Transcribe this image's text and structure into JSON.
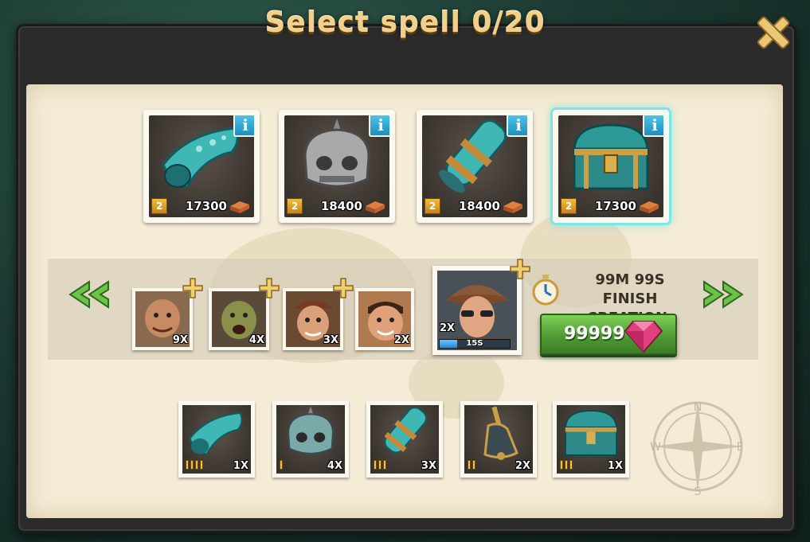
{
  "header": {
    "title": "Select spell 0/20"
  },
  "spells": [
    {
      "name": "horn",
      "level": "2",
      "cost": "17300",
      "selected": false
    },
    {
      "name": "skull-helmet",
      "level": "2",
      "cost": "18400",
      "selected": false
    },
    {
      "name": "cannon",
      "level": "2",
      "cost": "18400",
      "selected": false
    },
    {
      "name": "treasure-chest",
      "level": "2",
      "cost": "17300",
      "selected": true
    }
  ],
  "queue": {
    "units": [
      {
        "name": "ogre",
        "count": "9X"
      },
      {
        "name": "goblin",
        "count": "4X"
      },
      {
        "name": "pirate",
        "count": "3X"
      },
      {
        "name": "brawler",
        "count": "2X"
      }
    ],
    "active": {
      "name": "detective",
      "count": "2X",
      "timer": "15S",
      "progress": 0.25
    },
    "time_remaining": "99M  99S",
    "finish_label": "FINISH CREATION:",
    "finish_cost": "99999"
  },
  "inventory": [
    {
      "name": "horn",
      "count": "1X",
      "tally": 4
    },
    {
      "name": "skull-helmet",
      "count": "4X",
      "tally": 1
    },
    {
      "name": "cannon",
      "count": "3X",
      "tally": 3
    },
    {
      "name": "bell",
      "count": "2X",
      "tally": 2
    },
    {
      "name": "treasure-chest",
      "count": "1X",
      "tally": 3
    }
  ],
  "colors": {
    "title": "#f0d08a",
    "parchment": "#f4ecd6",
    "selected_glow": "#7fe5e2",
    "finish_button": "#4f9b33",
    "gem": "#e0407e"
  }
}
